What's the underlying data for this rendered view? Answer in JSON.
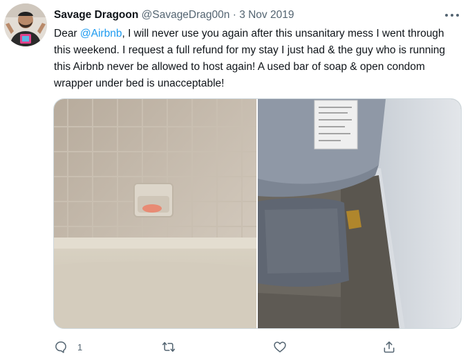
{
  "tweet": {
    "display_name": "Savage Dragoon",
    "handle": "@SavageDrag00n",
    "separator": "·",
    "date": "3 Nov 2019",
    "text_parts": {
      "before_mention": "Dear ",
      "mention": "@Airbnb",
      "after_mention": ", I will never use you again after this unsanitary mess I went through this weekend. I request a full refund for my stay I just had & the guy who is running this Airbnb never be allowed to host again! A used bar of soap & open condom wrapper under bed is unacceptable!"
    },
    "media": [
      {
        "name": "bathroom-soap-photo"
      },
      {
        "name": "under-bed-photo"
      }
    ],
    "actions": {
      "reply_count": "1",
      "retweet_count": "",
      "like_count": ""
    }
  },
  "icons": {
    "more": "more-horizontal-icon",
    "reply": "reply-bubble-icon",
    "retweet": "retweet-icon",
    "like": "heart-icon",
    "share": "share-upload-icon"
  },
  "colors": {
    "accent": "#1d9bf0",
    "text": "#0f1419",
    "secondary_text": "#536471",
    "border": "#cfd9de"
  }
}
